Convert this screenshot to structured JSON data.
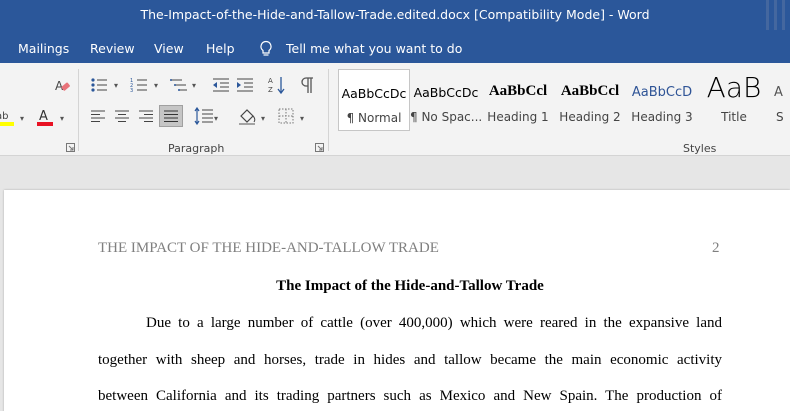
{
  "window": {
    "title": "The-Impact-of-the-Hide-and-Tallow-Trade.edited.docx [Compatibility Mode]  -  Word"
  },
  "ribbon_tabs": {
    "mailings": "Mailings",
    "review": "Review",
    "view": "View",
    "help": "Help",
    "tell_me": "Tell me what you want to do"
  },
  "ribbon": {
    "paragraph_group_label": "Paragraph",
    "styles_group_label": "Styles",
    "styles": [
      {
        "sample": "AaBbCcDc",
        "name": "¶ Normal"
      },
      {
        "sample": "AaBbCcDc",
        "name": "¶ No Spac..."
      },
      {
        "sample": "AaBbCcl",
        "name": "Heading 1"
      },
      {
        "sample": "AaBbCcl",
        "name": "Heading 2"
      },
      {
        "sample": "AaBbCcD",
        "name": "Heading 3"
      },
      {
        "sample": "AaB",
        "name": "Title"
      },
      {
        "sample": "A",
        "name": "S"
      }
    ]
  },
  "document": {
    "running_head": "THE IMPACT OF THE HIDE-AND-TALLOW TRADE",
    "page_number": "2",
    "title": "The Impact of the Hide-and-Tallow Trade",
    "lines": [
      "Due to a large number of cattle (over 400,000) which were reared in the expansive land",
      "together with sheep and horses, trade in hides and tallow became the main economic activity",
      "between California and its trading partners such as Mexico and New Spain. The production of"
    ]
  },
  "colors": {
    "title_bar": "#2b579a",
    "ribbon_bg": "#f3f3f3",
    "highlight_yellow": "#ffff00",
    "font_color_red": "#e81123"
  }
}
